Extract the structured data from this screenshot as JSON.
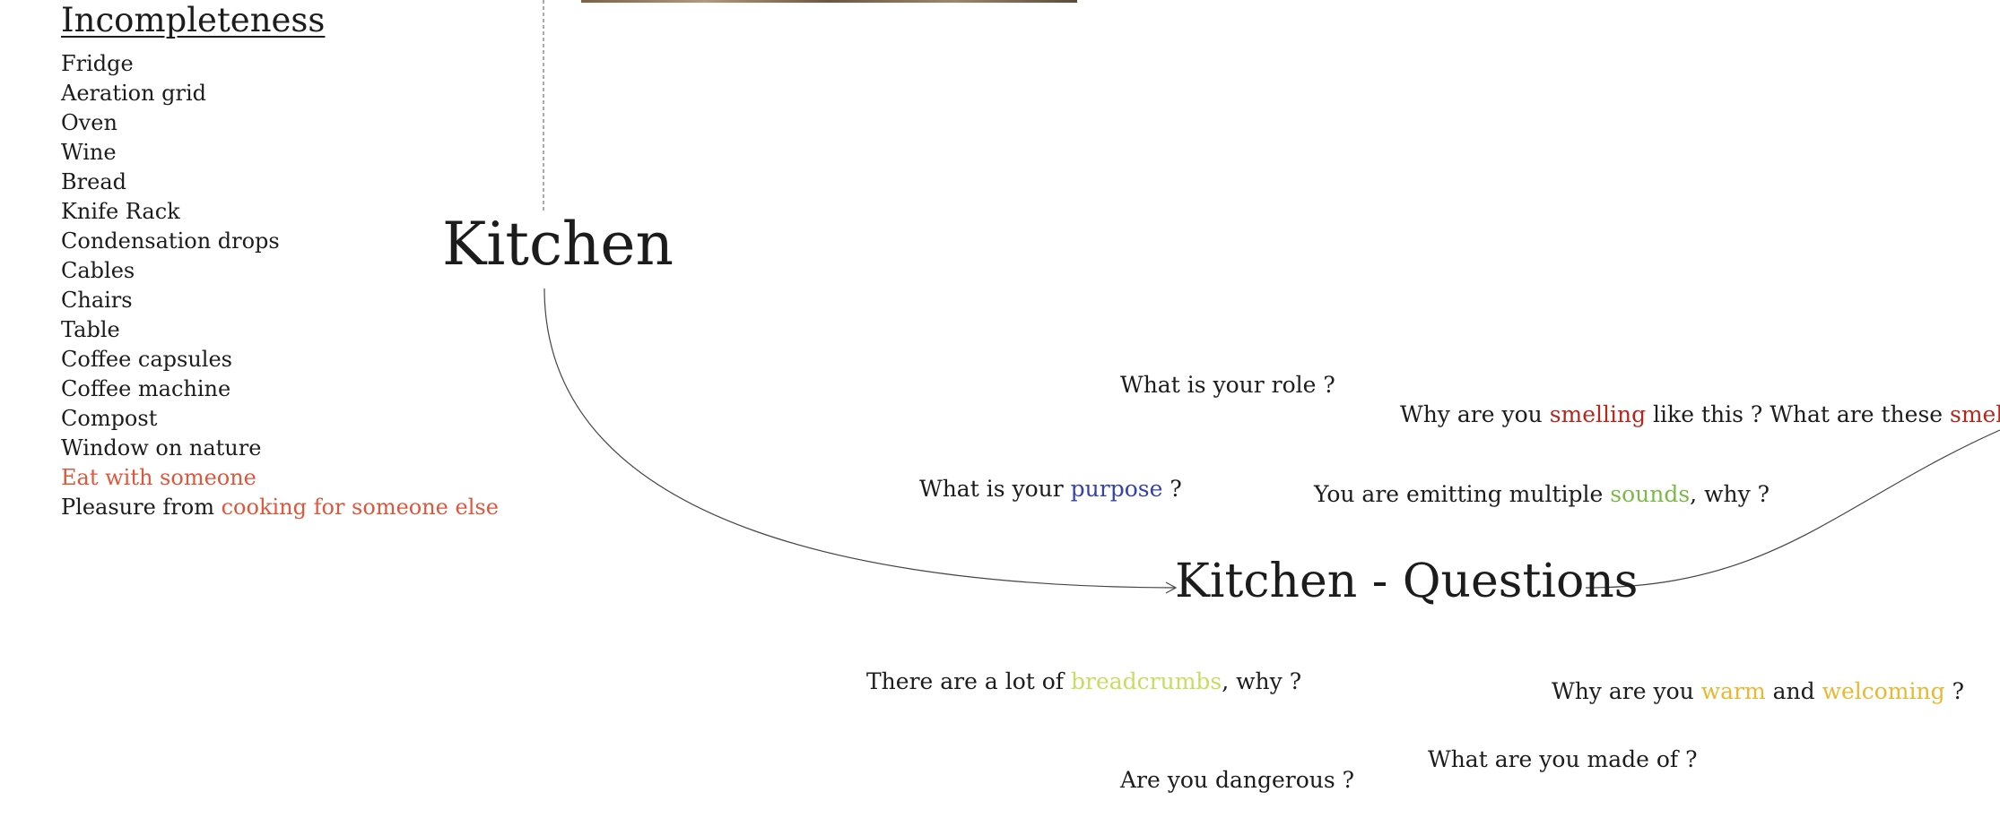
{
  "incompleteness": {
    "heading": "Incompleteness",
    "items": [
      "Fridge",
      "Aeration grid",
      "Oven",
      "Wine",
      "Bread",
      "Knife Rack",
      "Condensation drops",
      "Cables",
      "Chairs",
      "Table",
      "Coffee capsules",
      "Coffee machine",
      "Compost",
      "Window on nature"
    ],
    "highlighted_item": "Eat with someone",
    "last_item_prefix": "Pleasure from ",
    "last_item_highlight": "cooking for someone else"
  },
  "kitchen_title": "Kitchen",
  "questions_title": "Kitchen - Questions",
  "questions": {
    "role": "What is your role ?",
    "smell_a": "Why are you ",
    "smell_b": "smelling",
    "smell_c": " like this ? What are these ",
    "smell_d": "smells",
    "smell_e": " ?",
    "purpose_a": "What is your ",
    "purpose_b": "purpose",
    "purpose_c": " ?",
    "sounds_a": "You are emitting multiple ",
    "sounds_b": "sounds",
    "sounds_c": ", why ?",
    "crumbs_a": "There are a lot of ",
    "crumbs_b": "breadcrumbs",
    "crumbs_c": ", why ?",
    "warm_a": "Why are you ",
    "warm_b": "warm",
    "warm_c": " and ",
    "warm_d": "welcoming",
    "warm_e": " ?",
    "made": "What are you made of ?",
    "danger": "Are you dangerous ?"
  },
  "colors": {
    "orange": "#e0563a",
    "red": "#b5261c",
    "blue": "#3543a8",
    "green": "#7cb84a",
    "lime": "#c8dc62",
    "gold": "#e8b832"
  }
}
